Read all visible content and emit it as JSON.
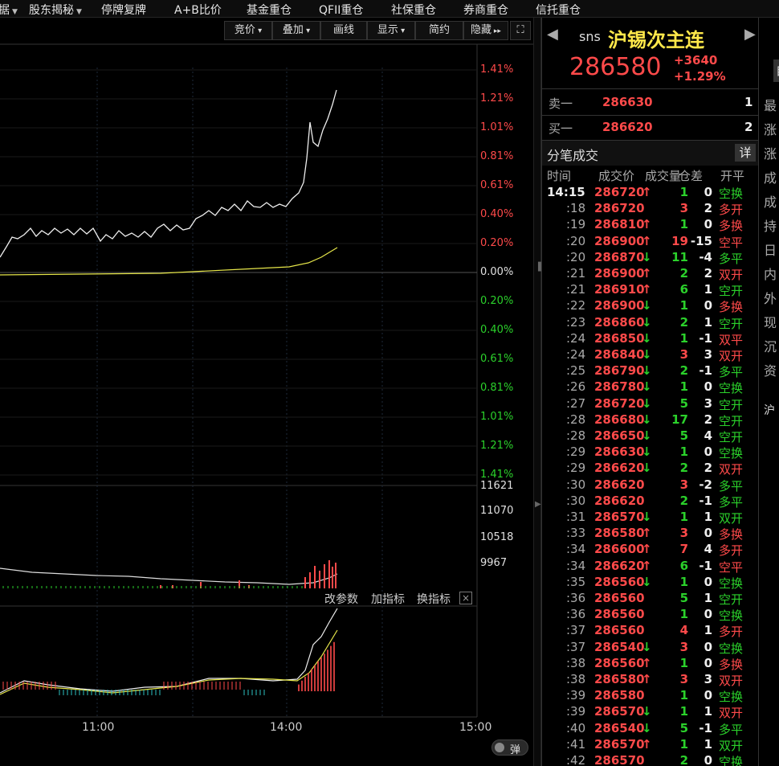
{
  "topnav": {
    "items": [
      {
        "label": "据",
        "caret": true
      },
      {
        "label": "股东揭秘",
        "caret": true
      },
      {
        "label": "停牌复牌",
        "caret": false
      },
      {
        "label": "A+B比价",
        "caret": false
      },
      {
        "label": "基金重仓",
        "caret": false
      },
      {
        "label": "QFII重仓",
        "caret": false
      },
      {
        "label": "社保重仓",
        "caret": false
      },
      {
        "label": "券商重仓",
        "caret": false
      },
      {
        "label": "信托重仓",
        "caret": false
      }
    ]
  },
  "toolbar": {
    "bid": "竞价",
    "overlay": "叠加",
    "draw": "画线",
    "display": "显示",
    "simple": "简约",
    "hide": "隐藏"
  },
  "price_axis": [
    "1.41%",
    "1.21%",
    "1.01%",
    "0.81%",
    "0.61%",
    "0.40%",
    "0.20%",
    "0.00%",
    "0.20%",
    "0.40%",
    "0.61%",
    "0.81%",
    "1.01%",
    "1.21%",
    "1.41%"
  ],
  "volume_axis": [
    "11621",
    "11070",
    "10518",
    "9967"
  ],
  "indicator_buttons": {
    "params": "改参数",
    "add": "加指标",
    "switch": "换指标"
  },
  "time_axis": [
    "11:00",
    "14:00",
    "15:00"
  ],
  "popup_toggle": "弹",
  "quote": {
    "code": "sns",
    "name": "沪锡次主连",
    "price": "286580",
    "change": "+3640",
    "change_pct": "+1.29%",
    "self_btn": "自",
    "ask_label": "卖一",
    "ask_price": "286630",
    "ask_vol": "1",
    "bid_label": "买一",
    "bid_price": "286620",
    "bid_vol": "2"
  },
  "ticks_header": {
    "title": "分笔成交",
    "detail": "详",
    "cols": [
      "时间",
      "成交价",
      "成交量",
      "仓差",
      "开平"
    ]
  },
  "ticks": [
    {
      "time": "14:15",
      "price": "286720",
      "dir": "up",
      "vol": "1",
      "oi": "0",
      "type": "空换",
      "tc": "green"
    },
    {
      "time": ":18",
      "price": "286720",
      "dir": "",
      "vol": "3",
      "oi": "2",
      "type": "多开",
      "tc": "red"
    },
    {
      "time": ":19",
      "price": "286810",
      "dir": "up",
      "vol": "1",
      "oi": "0",
      "type": "多换",
      "tc": "red"
    },
    {
      "time": ":20",
      "price": "286900",
      "dir": "up",
      "vol": "19",
      "oi": "-15",
      "type": "空平",
      "tc": "red"
    },
    {
      "time": ":20",
      "price": "286870",
      "dir": "down",
      "vol": "11",
      "oi": "-4",
      "type": "多平",
      "tc": "green"
    },
    {
      "time": ":21",
      "price": "286900",
      "dir": "up",
      "vol": "2",
      "oi": "2",
      "type": "双开",
      "tc": "red"
    },
    {
      "time": ":21",
      "price": "286910",
      "dir": "up",
      "vol": "6",
      "oi": "1",
      "type": "空开",
      "tc": "green"
    },
    {
      "time": ":22",
      "price": "286900",
      "dir": "down",
      "vol": "1",
      "oi": "0",
      "type": "多换",
      "tc": "red"
    },
    {
      "time": ":23",
      "price": "286860",
      "dir": "down",
      "vol": "2",
      "oi": "1",
      "type": "空开",
      "tc": "green"
    },
    {
      "time": ":24",
      "price": "286850",
      "dir": "down",
      "vol": "1",
      "oi": "-1",
      "type": "双平",
      "tc": "red"
    },
    {
      "time": ":24",
      "price": "286840",
      "dir": "down",
      "vol": "3",
      "oi": "3",
      "type": "双开",
      "tc": "red"
    },
    {
      "time": ":25",
      "price": "286790",
      "dir": "down",
      "vol": "2",
      "oi": "-1",
      "type": "多平",
      "tc": "green"
    },
    {
      "time": ":26",
      "price": "286780",
      "dir": "down",
      "vol": "1",
      "oi": "0",
      "type": "空换",
      "tc": "green"
    },
    {
      "time": ":27",
      "price": "286720",
      "dir": "down",
      "vol": "5",
      "oi": "3",
      "type": "空开",
      "tc": "green"
    },
    {
      "time": ":28",
      "price": "286680",
      "dir": "down",
      "vol": "17",
      "oi": "2",
      "type": "空开",
      "tc": "green"
    },
    {
      "time": ":28",
      "price": "286650",
      "dir": "down",
      "vol": "5",
      "oi": "4",
      "type": "空开",
      "tc": "green"
    },
    {
      "time": ":29",
      "price": "286630",
      "dir": "down",
      "vol": "1",
      "oi": "0",
      "type": "空换",
      "tc": "green"
    },
    {
      "time": ":29",
      "price": "286620",
      "dir": "down",
      "vol": "2",
      "oi": "2",
      "type": "双开",
      "tc": "red"
    },
    {
      "time": ":30",
      "price": "286620",
      "dir": "",
      "vol": "3",
      "oi": "-2",
      "type": "多平",
      "tc": "green"
    },
    {
      "time": ":30",
      "price": "286620",
      "dir": "",
      "vol": "2",
      "oi": "-1",
      "type": "多平",
      "tc": "green"
    },
    {
      "time": ":31",
      "price": "286570",
      "dir": "down",
      "vol": "1",
      "oi": "1",
      "type": "双开",
      "tc": "green"
    },
    {
      "time": ":33",
      "price": "286580",
      "dir": "up",
      "vol": "3",
      "oi": "0",
      "type": "多换",
      "tc": "red"
    },
    {
      "time": ":34",
      "price": "286600",
      "dir": "up",
      "vol": "7",
      "oi": "4",
      "type": "多开",
      "tc": "red"
    },
    {
      "time": ":34",
      "price": "286620",
      "dir": "up",
      "vol": "6",
      "oi": "-1",
      "type": "空平",
      "tc": "red"
    },
    {
      "time": ":35",
      "price": "286560",
      "dir": "down",
      "vol": "1",
      "oi": "0",
      "type": "空换",
      "tc": "green"
    },
    {
      "time": ":36",
      "price": "286560",
      "dir": "",
      "vol": "5",
      "oi": "1",
      "type": "空开",
      "tc": "green"
    },
    {
      "time": ":36",
      "price": "286560",
      "dir": "",
      "vol": "1",
      "oi": "0",
      "type": "空换",
      "tc": "green"
    },
    {
      "time": ":37",
      "price": "286560",
      "dir": "",
      "vol": "4",
      "oi": "1",
      "type": "多开",
      "tc": "red"
    },
    {
      "time": ":37",
      "price": "286540",
      "dir": "down",
      "vol": "3",
      "oi": "0",
      "type": "空换",
      "tc": "green"
    },
    {
      "time": ":38",
      "price": "286560",
      "dir": "up",
      "vol": "1",
      "oi": "0",
      "type": "多换",
      "tc": "red"
    },
    {
      "time": ":38",
      "price": "286580",
      "dir": "up",
      "vol": "3",
      "oi": "3",
      "type": "双开",
      "tc": "red"
    },
    {
      "time": ":39",
      "price": "286580",
      "dir": "",
      "vol": "1",
      "oi": "0",
      "type": "空换",
      "tc": "green"
    },
    {
      "time": ":39",
      "price": "286570",
      "dir": "down",
      "vol": "1",
      "oi": "1",
      "type": "双开",
      "tc": "red"
    },
    {
      "time": ":40",
      "price": "286540",
      "dir": "down",
      "vol": "5",
      "oi": "-1",
      "type": "多平",
      "tc": "green"
    },
    {
      "time": ":41",
      "price": "286570",
      "dir": "up",
      "vol": "1",
      "oi": "1",
      "type": "双开",
      "tc": "green"
    },
    {
      "time": ":42",
      "price": "286570",
      "dir": "",
      "vol": "2",
      "oi": "0",
      "type": "空换",
      "tc": "green"
    }
  ],
  "far_right": {
    "labels": [
      "最",
      "涨",
      "涨",
      "成",
      "成",
      "持",
      "日",
      "内",
      "外",
      "现",
      "沉",
      "资"
    ],
    "bottom": "沪"
  }
}
